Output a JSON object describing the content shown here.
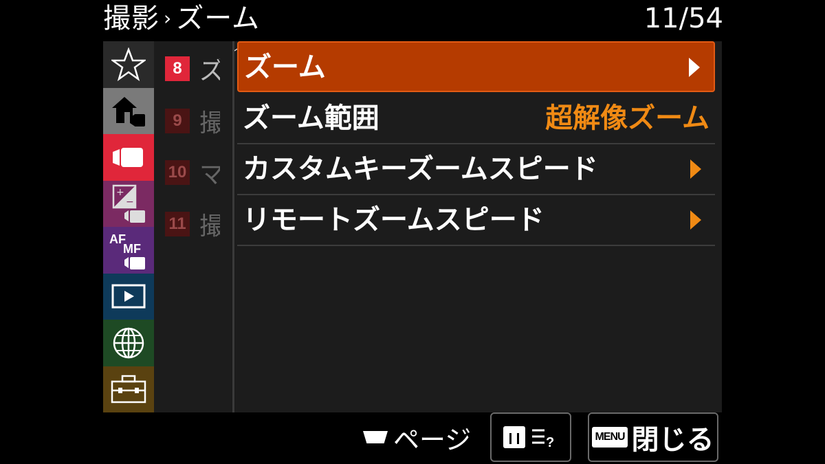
{
  "header": {
    "breadcrumb_parent": "撮影",
    "breadcrumb_sep": "›",
    "title": "ズーム",
    "page_counter": "11/54"
  },
  "categories": [
    {
      "name": "my-menu",
      "icon": "star-icon",
      "color": "#2a2a2a",
      "active": false
    },
    {
      "name": "main",
      "icon": "home-movie-icon",
      "color": "#7a7a7a",
      "active": false
    },
    {
      "name": "shooting",
      "icon": "movie-camera-icon",
      "color": "#e0263a",
      "active": true
    },
    {
      "name": "exposure-color",
      "icon": "exposure-icon",
      "color": "#7b2a62",
      "active": false
    },
    {
      "name": "focus",
      "icon": "af-mf-icon",
      "color": "#5a2a7a",
      "active": false
    },
    {
      "name": "playback",
      "icon": "playback-icon",
      "color": "#0e3a5a",
      "active": false
    },
    {
      "name": "network",
      "icon": "globe-icon",
      "color": "#1e4a24",
      "active": false
    },
    {
      "name": "setup",
      "icon": "toolbox-icon",
      "color": "#5a4210",
      "active": false
    }
  ],
  "pages": [
    {
      "num": "8",
      "glyph": "ズ",
      "active": true
    },
    {
      "num": "9",
      "glyph": "撮",
      "active": false
    },
    {
      "num": "10",
      "glyph": "マ",
      "active": false
    },
    {
      "num": "11",
      "glyph": "撮",
      "active": false
    }
  ],
  "menu_items": [
    {
      "label": "ズーム",
      "value": "",
      "arrow": true,
      "selected": true
    },
    {
      "label": "ズーム範囲",
      "value": "超解像ズーム",
      "arrow": false,
      "selected": false
    },
    {
      "label": "カスタムキーズームスピード",
      "value": "",
      "arrow": true,
      "selected": false
    },
    {
      "label": "リモートズームスピード",
      "value": "",
      "arrow": true,
      "selected": false
    }
  ],
  "footer": {
    "page_label": "ページ",
    "menu_badge": "MENU",
    "close_label": "閉じる"
  },
  "colors": {
    "accent": "#f08a14",
    "selected_row": "#b53b00",
    "active_page": "#e0263a"
  }
}
